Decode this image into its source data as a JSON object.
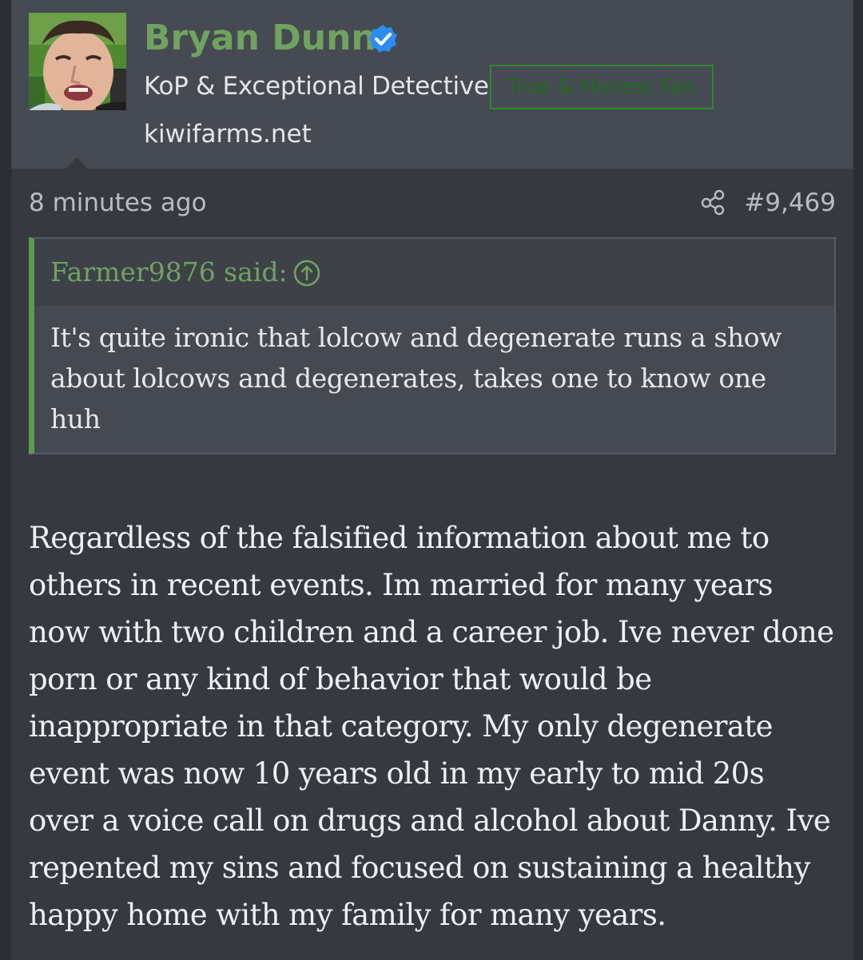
{
  "user": {
    "name": "Bryan Dunn",
    "title": "KoP & Exceptional Detective",
    "banner": "True & Honest Fan",
    "site": "kiwifarms.net"
  },
  "post": {
    "time": "8 minutes ago",
    "number": "#9,469",
    "quote": {
      "author": "Farmer9876 said:",
      "text": "It's quite ironic that lolcow and degenerate runs a show about lolcows and degenerates, takes one to know one huh"
    },
    "body": "Regardless of the falsified information about me to others in recent events. Im married for many years now with two children and a career job. Ive never done porn or any kind of behavior that would be inappropriate in that category. My only degenerate event was now 10 years old in my early to mid 20s over a voice call on drugs and alcohol about Danny. Ive repented my sins and focused on sustaining a healthy happy home with my family for many years."
  },
  "icons": {
    "verified": "verified-badge-icon",
    "share": "share-icon",
    "quote_expand": "arrow-up-circle-icon"
  },
  "colors": {
    "username": "#6fa35f",
    "verified": "#2d8cf0",
    "banner_border": "#2a8a2a",
    "quote_accent": "#5b9c4c",
    "background": "#363940"
  }
}
